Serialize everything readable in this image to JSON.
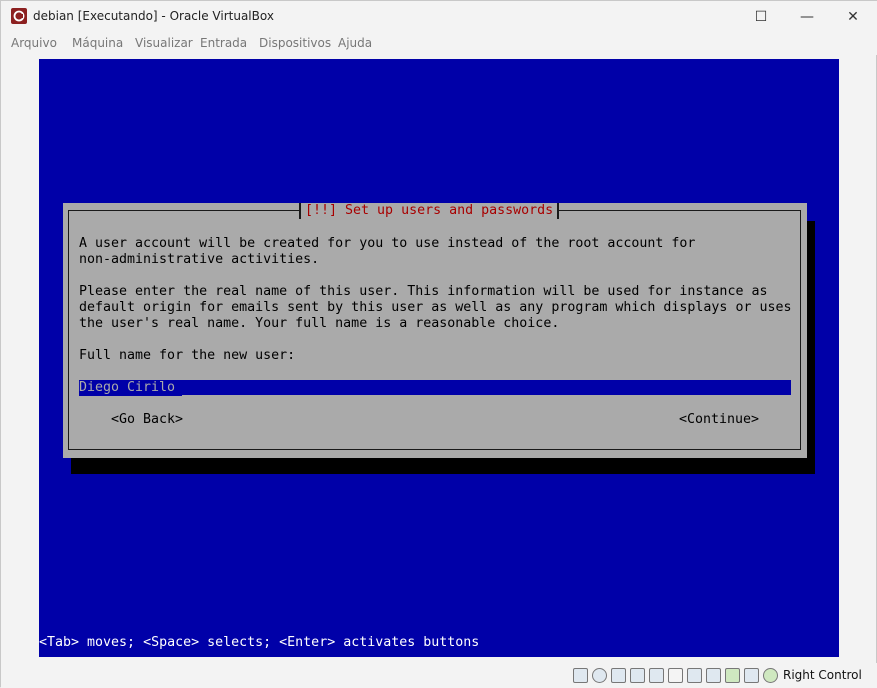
{
  "window": {
    "title": "debian [Executando] - Oracle VirtualBox",
    "controls": {
      "minimize": "—",
      "maximize": "☐",
      "close": "✕"
    }
  },
  "menu": [
    "Arquivo",
    "Máquina",
    "Visualizar",
    "Entrada",
    "Dispositivos",
    "Ajuda"
  ],
  "installer": {
    "dialog_title": "[!!] Set up users and passwords",
    "paragraph1_line1": "A user account will be created for you to use instead of the root account for",
    "paragraph1_line2": "non-administrative activities.",
    "paragraph2_line1": "Please enter the real name of this user. This information will be used for instance as",
    "paragraph2_line2": "default origin for emails sent by this user as well as any program which displays or uses",
    "paragraph2_line3": "the user's real name. Your full name is a reasonable choice.",
    "field_label": "Full name for the new user:",
    "field_value": "Diego Cirilo",
    "go_back": "<Go Back>",
    "continue": "<Continue>",
    "help_line": "<Tab> moves; <Space> selects; <Enter> activates buttons"
  },
  "statusbar": {
    "icons": [
      "hard-disk-icon",
      "optical-drive-icon",
      "audio-icon",
      "network-icon",
      "usb-icon",
      "shared-folders-icon",
      "display-icon",
      "video-capture-icon",
      "recording-icon",
      "cpu-icon",
      "mouse-integration-icon",
      "keyboard-capture-icon"
    ],
    "host_key": "Right Control"
  },
  "colors": {
    "vm_background": "#0000a8",
    "dialog_background": "#aaaaaa",
    "dialog_title": "#a80000"
  }
}
